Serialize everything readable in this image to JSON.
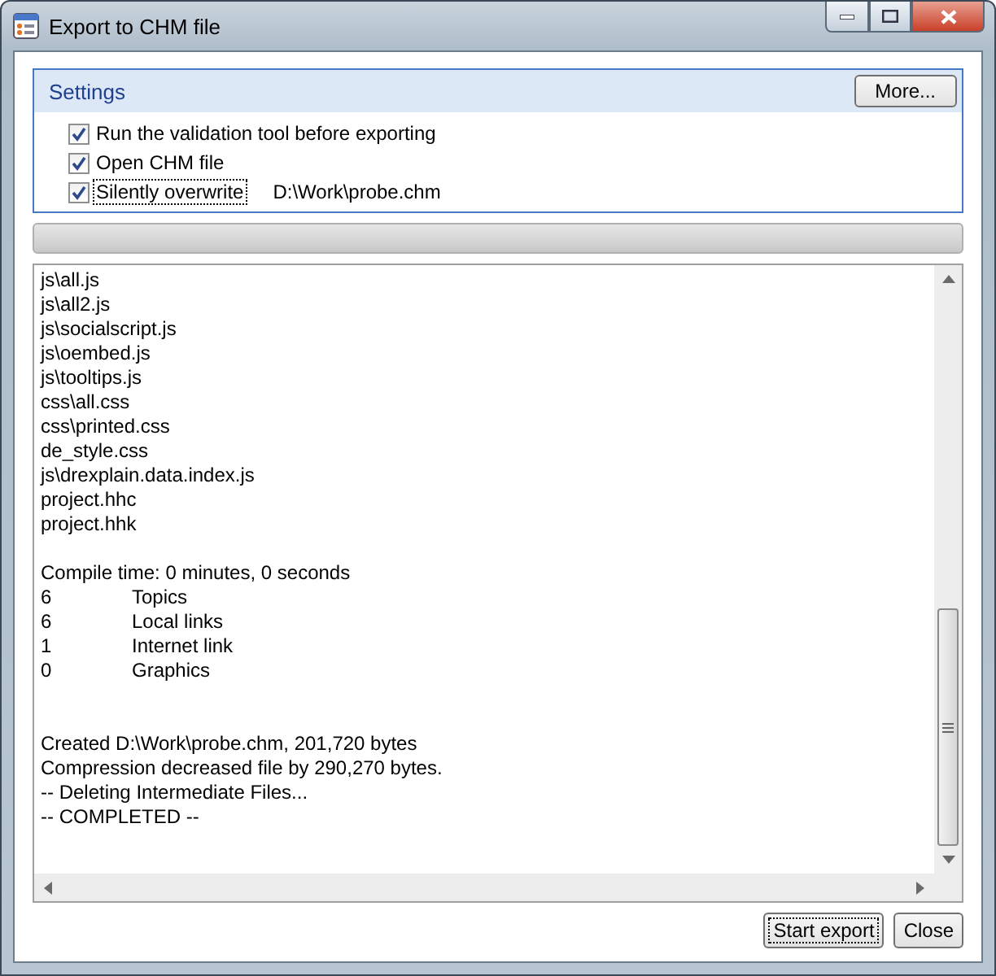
{
  "window": {
    "title": "Export to CHM file"
  },
  "settings": {
    "title": "Settings",
    "more_button": "More...",
    "options": [
      {
        "label": "Run the validation tool before exporting",
        "checked": true,
        "focused": false
      },
      {
        "label": "Open CHM file",
        "checked": true,
        "focused": false
      },
      {
        "label": "Silently overwrite",
        "checked": true,
        "focused": true,
        "value": "D:\\Work\\probe.chm"
      }
    ]
  },
  "progress": {
    "level": 0
  },
  "log": [
    {
      "kind": "text",
      "text": "js\\all.js"
    },
    {
      "kind": "text",
      "text": "js\\all2.js"
    },
    {
      "kind": "text",
      "text": "js\\socialscript.js"
    },
    {
      "kind": "text",
      "text": "js\\oembed.js"
    },
    {
      "kind": "text",
      "text": "js\\tooltips.js"
    },
    {
      "kind": "text",
      "text": "css\\all.css"
    },
    {
      "kind": "text",
      "text": "css\\printed.css"
    },
    {
      "kind": "text",
      "text": "de_style.css"
    },
    {
      "kind": "text",
      "text": "js\\drexplain.data.index.js"
    },
    {
      "kind": "text",
      "text": "project.hhc"
    },
    {
      "kind": "text",
      "text": "project.hhk"
    },
    {
      "kind": "blank"
    },
    {
      "kind": "text",
      "text": "Compile time: 0 minutes, 0 seconds"
    },
    {
      "kind": "stat",
      "count": "6",
      "label": "Topics"
    },
    {
      "kind": "stat",
      "count": "6",
      "label": "Local links"
    },
    {
      "kind": "stat",
      "count": "1",
      "label": "Internet link"
    },
    {
      "kind": "stat",
      "count": "0",
      "label": "Graphics"
    },
    {
      "kind": "blank"
    },
    {
      "kind": "blank"
    },
    {
      "kind": "text",
      "text": "Created D:\\Work\\probe.chm, 201,720 bytes"
    },
    {
      "kind": "text",
      "text": "Compression decreased file by 290,270 bytes."
    },
    {
      "kind": "text",
      "text": "-- Deleting Intermediate Files..."
    },
    {
      "kind": "text",
      "text": "-- COMPLETED --"
    }
  ],
  "buttons": [
    {
      "label": "Start export",
      "focused": true
    },
    {
      "label": "Close",
      "focused": false
    }
  ]
}
